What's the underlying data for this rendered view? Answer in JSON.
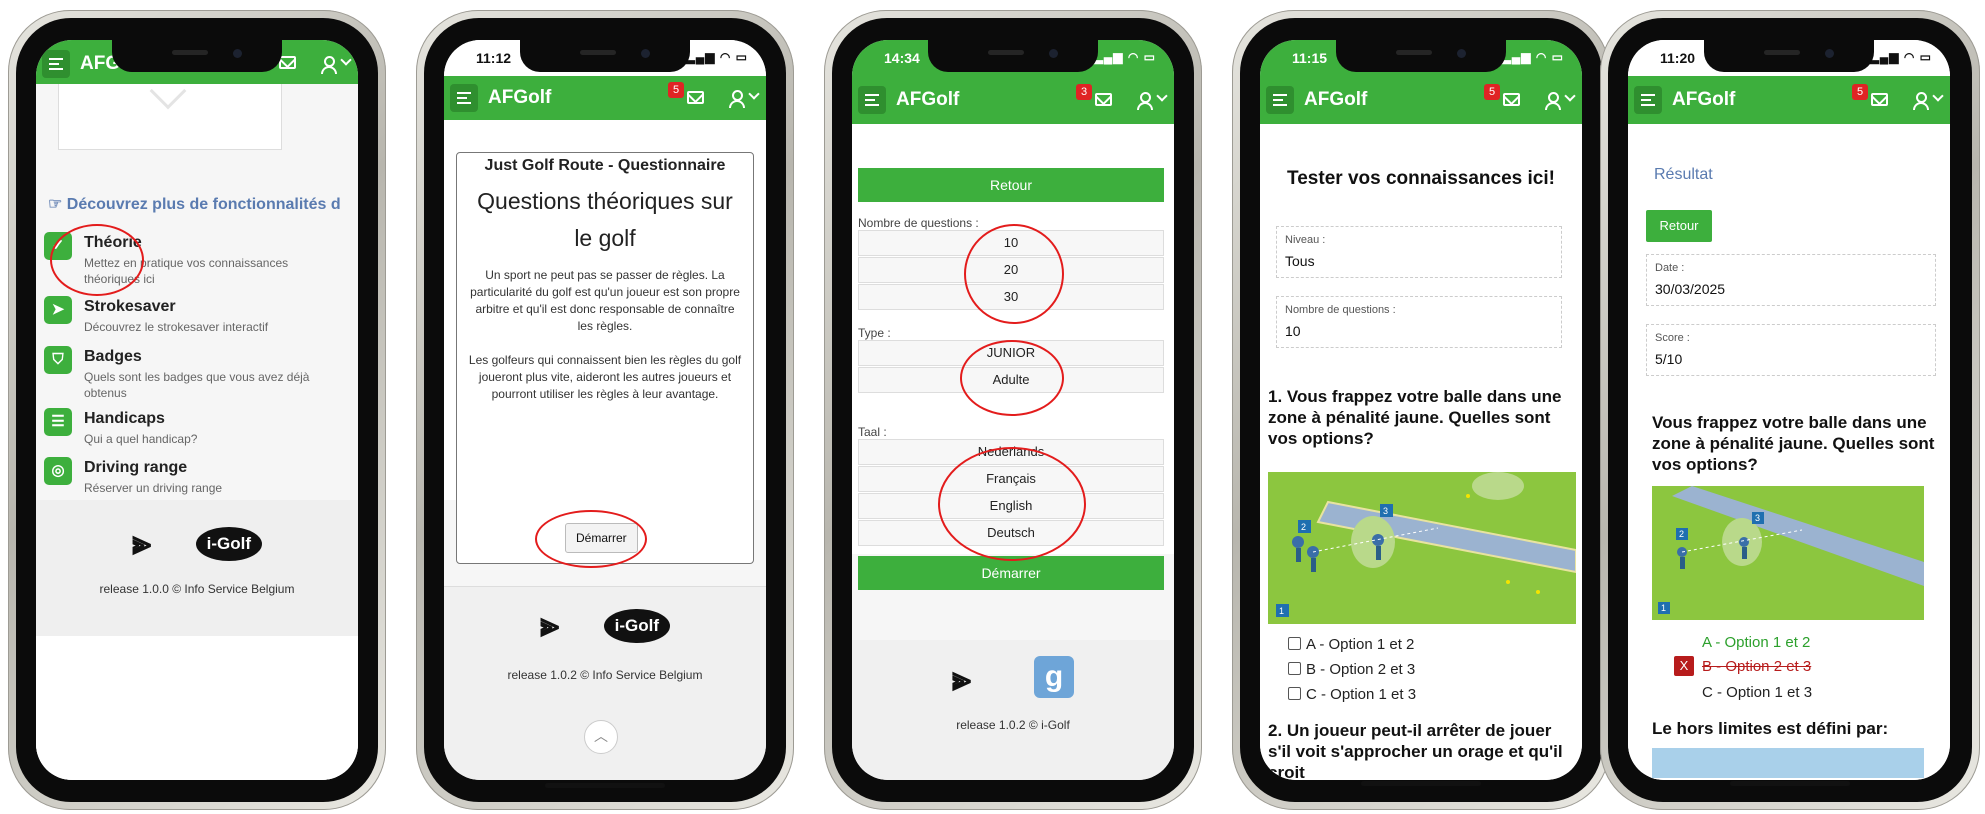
{
  "app": {
    "title": "AFGolf"
  },
  "phones": {
    "p1": {
      "status_time": "",
      "discover": "Découvrez plus de fonctionnalités d",
      "features": [
        {
          "title": "Théorie",
          "desc": "Mettez en pratique vos connaissances théoriques ici",
          "icon": "clipboard-icon"
        },
        {
          "title": "Strokesaver",
          "desc": "Découvrez le strokesaver interactif",
          "icon": "navigation-arrow-icon"
        },
        {
          "title": "Badges",
          "desc": "Quels sont les badges que vous avez déjà obtenus",
          "icon": "shield-icon"
        },
        {
          "title": "Handicaps",
          "desc": "Qui a quel handicap?",
          "icon": "list-icon"
        },
        {
          "title": "Driving range",
          "desc": "Réserver un driving range",
          "icon": "target-icon"
        }
      ],
      "logo_text": "i-Golf",
      "release": "release 1.0.0 © Info Service Belgium"
    },
    "p2": {
      "status_time": "11:12",
      "badge": "5",
      "card_heading": "Just Golf Route - Questionnaire",
      "card_title": "Questions théoriques sur le golf",
      "para1": "Un sport ne peut pas se passer de règles. La particularité du golf est qu'un joueur est son propre arbitre et qu'il est donc responsable de connaître les règles.",
      "para2": "Les golfeurs qui connaissent bien les règles du golf joueront plus vite, aideront les autres joueurs et pourront utiliser les règles à leur avantage.",
      "start": "Démarrer",
      "logo_text": "i-Golf",
      "release": "release 1.0.2 © Info Service Belgium"
    },
    "p3": {
      "status_time": "14:34",
      "badge": "3",
      "back": "Retour",
      "q_label": "Nombre de questions :",
      "q_options": [
        "10",
        "20",
        "30"
      ],
      "type_label": "Type :",
      "type_options": [
        "JUNIOR",
        "Adulte"
      ],
      "lang_label": "Taal :",
      "lang_options": [
        "Nederlands",
        "Français",
        "English",
        "Deutsch"
      ],
      "start": "Démarrer",
      "release": "release 1.0.2 © i-Golf"
    },
    "p4": {
      "status_time": "11:15",
      "badge": "5",
      "heading": "Tester vos connaissances ici!",
      "level_label": "Niveau :",
      "level_value": "Tous",
      "count_label": "Nombre de questions :",
      "count_value": "10",
      "q1": "1. Vous frappez votre balle dans une zone à pénalité jaune. Quelles sont vos options?",
      "answers": [
        "A - Option 1 et 2",
        "B - Option 2 et 3",
        "C - Option 1 et 3"
      ],
      "q2": "2. Un joueur peut-il arrêter de jouer s'il voit s'approcher un orage et qu'il croit"
    },
    "p5": {
      "status_time": "11:20",
      "badge": "5",
      "result_title": "Résultat",
      "back": "Retour",
      "date_label": "Date :",
      "date_value": "30/03/2025",
      "score_label": "Score :",
      "score_value": "5/10",
      "question": "Vous frappez votre balle dans une zone à pénalité jaune. Quelles sont vos options?",
      "answers": [
        "A - Option 1 et 2",
        "B - Option 2 et 3",
        "C - Option 1 et 3"
      ],
      "wrong_mark": "X",
      "next_title": "Le hors limites est défini par:"
    }
  },
  "colors": {
    "brand_green": "#3daf3d",
    "badge_red": "#e02424",
    "annotation_red": "#e31c1c",
    "correct_green": "#2ca02c",
    "wrong_red": "#b71c1c"
  }
}
